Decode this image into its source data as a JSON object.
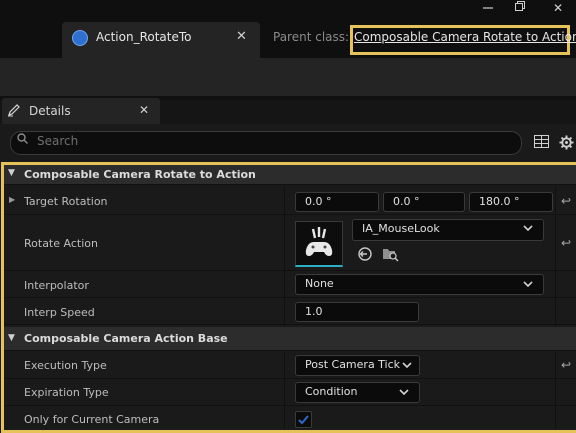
{
  "window": {
    "restore_glyph": "⧉",
    "close_glyph": "✕"
  },
  "asset_tab": {
    "label": "Action_RotateTo",
    "close_glyph": "✕"
  },
  "parent": {
    "label": "Parent class:",
    "value": "Composable Camera Rotate to Action"
  },
  "details_tab": {
    "label": "Details",
    "close_glyph": "✕"
  },
  "search": {
    "placeholder": "Search"
  },
  "categories": {
    "rotate_to": "Composable Camera Rotate to Action",
    "action_base": "Composable Camera Action Base"
  },
  "properties": {
    "target_rotation": {
      "label": "Target Rotation",
      "x": "0.0 °",
      "y": "0.0 °",
      "z": "180.0 °"
    },
    "rotate_action": {
      "label": "Rotate Action",
      "value": "IA_MouseLook"
    },
    "interpolator": {
      "label": "Interpolator",
      "value": "None"
    },
    "interp_speed": {
      "label": "Interp Speed",
      "value": "1.0"
    },
    "execution_type": {
      "label": "Execution Type",
      "value": "Post Camera Tick"
    },
    "expiration_type": {
      "label": "Expiration Type",
      "value": "Condition"
    },
    "only_current_camera": {
      "label": "Only for Current Camera",
      "checked": true
    }
  },
  "colors": {
    "highlight": "#e6c25a",
    "accent": "#2f6fcf",
    "checkbox": "#2a6bd0"
  }
}
